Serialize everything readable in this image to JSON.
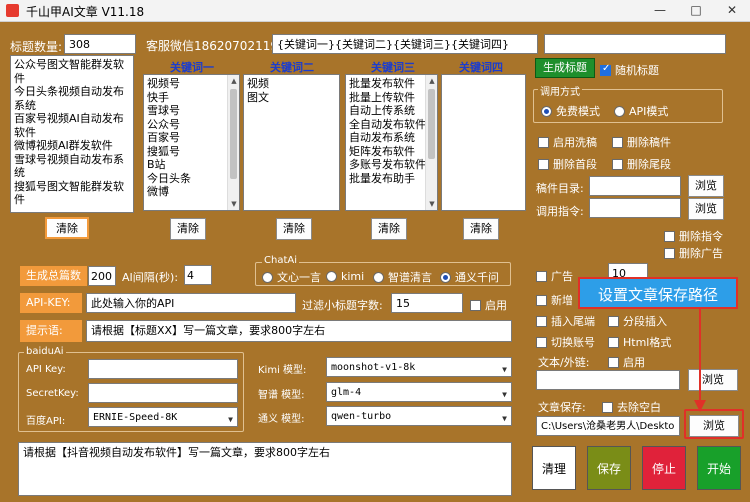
{
  "window": {
    "title": "千山甲AI文章 V11.18",
    "minimize": "—",
    "maximize": "□",
    "close": "✕"
  },
  "top": {
    "title_count_label": "标题数量:",
    "title_count_value": "308",
    "service": "客服微信18620702119",
    "keyword_template": "{关键词一}{关键词二}{关键词三}{关键词四}",
    "extra_field": ""
  },
  "titles_list": [
    "公众号图文智能群发软",
    "件",
    "今日头条视频自动发布",
    "系统",
    "百家号视频AI自动发布",
    "软件",
    "微博视频AI群发软件",
    "雪球号视频自动发布系",
    "统",
    "搜狐号图文智能群发软",
    "件"
  ],
  "keyword_columns": [
    {
      "header": "关键词一",
      "items": [
        "视频号",
        "快手",
        "雪球号",
        "公众号",
        "百家号",
        "搜狐号",
        "B站",
        "今日头条",
        "微博"
      ]
    },
    {
      "header": "关键词二",
      "items": [
        "视频",
        "图文"
      ]
    },
    {
      "header": "关键词三",
      "items": [
        "批量发布软件",
        "批量上传软件",
        "自动上传系统",
        "全自动发布软件",
        "自动发布系统",
        "矩阵发布软件",
        "多账号发布软件",
        "批量发布助手"
      ]
    },
    {
      "header": "关键词四",
      "items": []
    }
  ],
  "clear_label": "清除",
  "generate_title": "生成标题",
  "random_title": "随机标题",
  "call_method": {
    "title": "调用方式",
    "free": "免费模式",
    "api": "API模式"
  },
  "options": {
    "wash": "启用洗稿",
    "del_draft": "删除稿件",
    "del_first": "删除首段",
    "del_last": "删除尾段"
  },
  "dirs": {
    "draft_label": "稿件目录:",
    "command_label": "调用指令:",
    "browse": "浏览"
  },
  "opts2": {
    "del_cmd": "删除指令",
    "del_ad": "删除广告"
  },
  "gen": {
    "total_label": "生成总篇数",
    "total_value": "200",
    "interval_label": "AI间隔(秒):",
    "interval_value": "4"
  },
  "chatai": {
    "title": "ChatAi",
    "opts": [
      "文心一言",
      "kimi",
      "智谱清言",
      "通义千问"
    ]
  },
  "api": {
    "key_label": "API-KEY:",
    "key_value": "此处输入你的API",
    "filter_label": "过滤小标题字数:",
    "filter_value": "15",
    "enable": "启用"
  },
  "prompt": {
    "label": "提示语:",
    "value": "请根据【标题XX】写一篇文章，要求800字左右"
  },
  "baidu": {
    "title": "baiduAi",
    "apikey_label": "API Key:",
    "secret_label": "SecretKey:",
    "api_label": "百度API:",
    "api_value": "ERNIE-Speed-8K"
  },
  "models": {
    "kimi_label": "Kimi 模型:",
    "kimi_value": "moonshot-v1-8k",
    "zhipu_label": "智谱 模型:",
    "zhipu_value": "glm-4",
    "tongyi_label": "通义 模型:",
    "tongyi_value": "qwen-turbo"
  },
  "right2": {
    "ad_label": "广告",
    "ad_value": "10",
    "add_label": "新增",
    "insert_tail": "插入尾端",
    "segment_insert": "分段插入",
    "switch_account": "切换账号",
    "html_format": "Html格式",
    "text_link_label": "文本/外链:",
    "enable": "启用",
    "browse": "浏览",
    "save_label": "文章保存:",
    "remove_blank": "去除空白",
    "save_path": "C:\\Users\\沧桑老男人\\Deskto"
  },
  "callout": "设置文章保存路径",
  "bottom_prompt": "请根据【抖音视频自动发布软件】写一篇文章，要求800字左右",
  "actions": {
    "clean": "清理",
    "save": "保存",
    "stop": "停止",
    "start": "开始"
  },
  "colors": {
    "accent_red": "#e03028",
    "callout_bg": "#2d9ee8",
    "bg": "#a8742a",
    "save_green": "#7a8d17",
    "stop_red": "#e0223a",
    "start_green": "#18a02a"
  }
}
